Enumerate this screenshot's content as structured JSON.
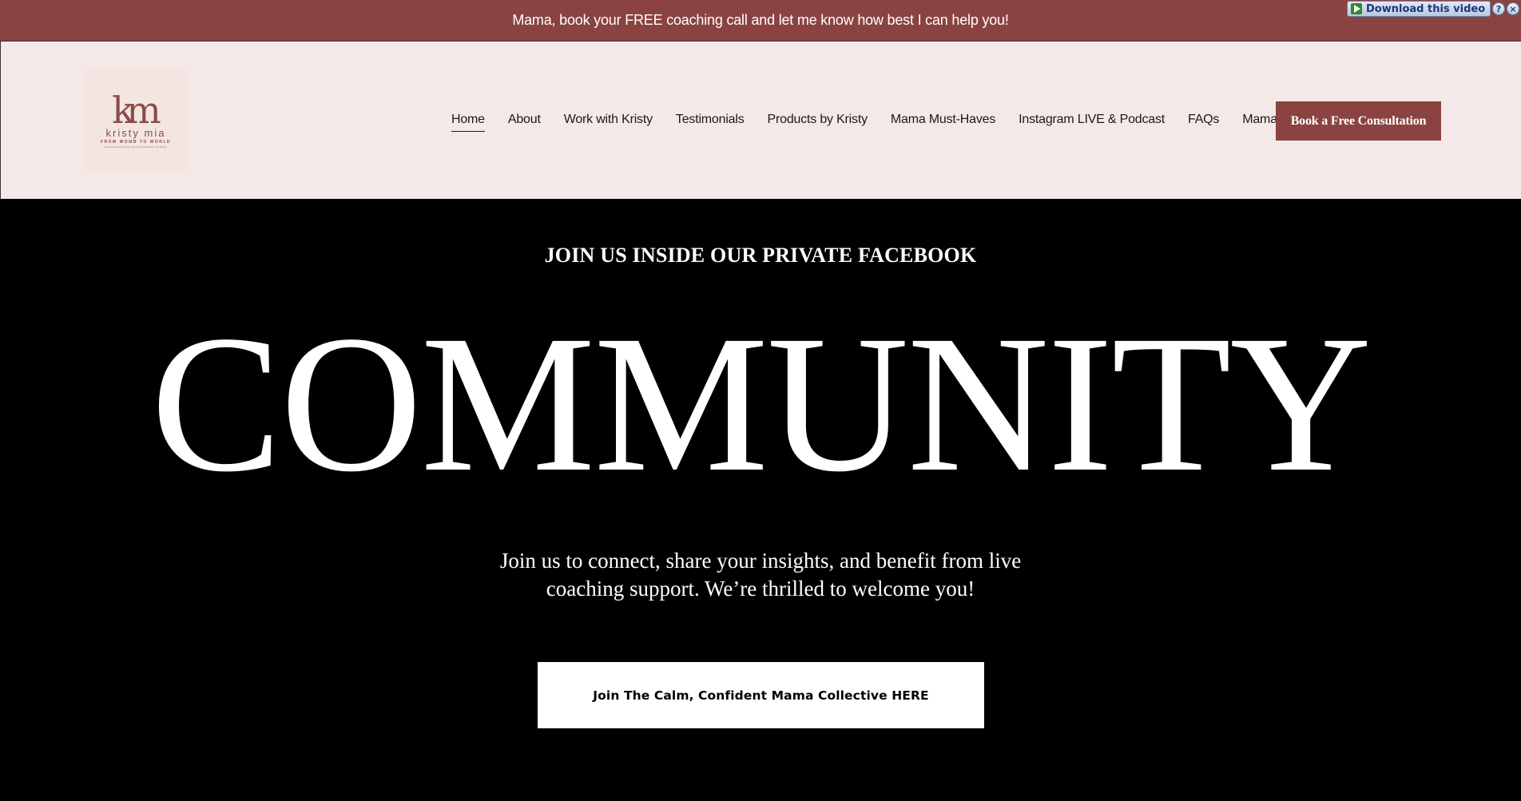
{
  "announcement": {
    "text": "Mama, book your FREE coaching call and let me know how best I can help you!"
  },
  "download_widget": {
    "label": "Download this video",
    "help_glyph": "?",
    "close_glyph": "×"
  },
  "logo": {
    "mark": "km",
    "name": "kristy mia",
    "tagline": "FROM WOMB TO WORLD",
    "subline": "Empowering Moms with Confidence & Calm"
  },
  "nav": {
    "items": [
      {
        "label": "Home",
        "active": true
      },
      {
        "label": "About"
      },
      {
        "label": "Work with Kristy"
      },
      {
        "label": "Testimonials"
      },
      {
        "label": "Products by Kristy"
      },
      {
        "label": "Mama Must-Haves"
      },
      {
        "label": "Instagram LIVE & Podcast"
      },
      {
        "label": "FAQs"
      },
      {
        "label": "Mama Blog"
      }
    ],
    "cta_label": "Book a Free Consultation"
  },
  "hero": {
    "kicker": "JOIN US INSIDE OUR PRIVATE FACEBOOK",
    "title": "COMMUNITY",
    "body": "Join us to connect, share your insights, and benefit from live coaching support. We’re thrilled to welcome you!",
    "button_label": "Join The Calm, Confident Mama Collective HERE"
  },
  "colors": {
    "brand": "#8a4340",
    "header_bg": "#f4e9e8",
    "hero_bg": "#000000"
  }
}
